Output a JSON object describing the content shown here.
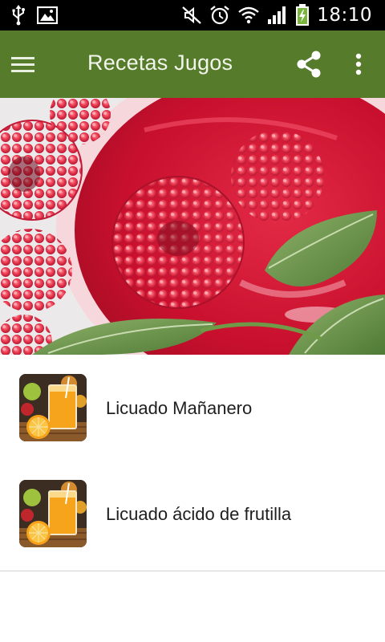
{
  "status_bar": {
    "time": "18:10",
    "icons": [
      "usb-icon",
      "image-notification-icon",
      "mute-icon",
      "alarm-icon",
      "wifi-icon",
      "signal-icon",
      "battery-charging-icon"
    ]
  },
  "app_bar": {
    "title": "Recetas Jugos",
    "background_color": "#567c2b",
    "icons": [
      "hamburger-menu-icon",
      "share-icon",
      "overflow-menu-icon"
    ]
  },
  "hero": {
    "subject": "raspberry-juice-photo"
  },
  "recipes": [
    {
      "label": "Licuado Mañanero",
      "thumbnail": "orange-juice-thumbnail"
    },
    {
      "label": "Licuado ácido de frutilla",
      "thumbnail": "orange-juice-thumbnail"
    }
  ]
}
